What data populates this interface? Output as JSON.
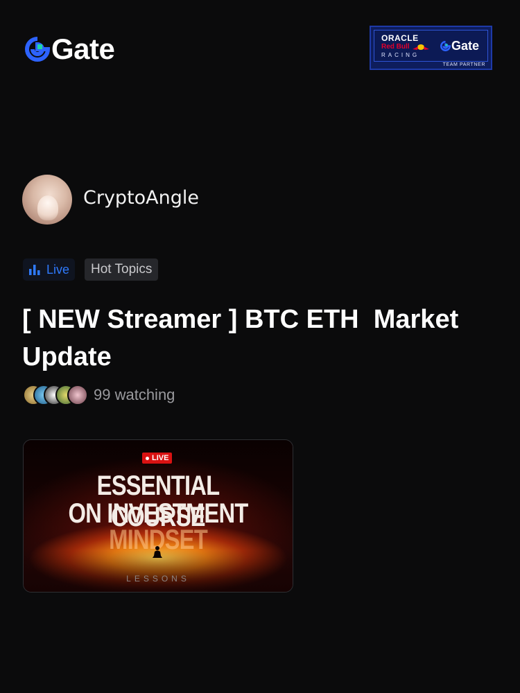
{
  "brand": {
    "logo_text": "Gate",
    "accent": "#2d63ff",
    "accent_secondary": "#1fd6a7"
  },
  "partner_badge": {
    "line1": "ORACLE",
    "line2": "Red Bull",
    "line3": "RACING",
    "brand": "Gate",
    "caption": "TEAM PARTNER"
  },
  "streamer": {
    "name": "CryptoAngle",
    "avatar_icon": "avatar-photo"
  },
  "tags": {
    "live_label": "Live",
    "live_icon": "bar-chart-icon",
    "topic_label": "Hot Topics",
    "live_color": "#2f7bff"
  },
  "stream": {
    "title": "[ NEW Streamer ] BTC ETH  Market Update",
    "watching_text": "99 watching",
    "watcher_avatars": [
      "#c7a868",
      "#2b8fc9",
      "#d8d8d8",
      "#7aa35a",
      "#b26a78"
    ]
  },
  "thumbnail": {
    "badge": "LIVE",
    "line1": "ESSENTIAL COURSE",
    "line2": "ON INVESTMENT",
    "line3": "MINDSET",
    "footer": "LESSONS"
  }
}
